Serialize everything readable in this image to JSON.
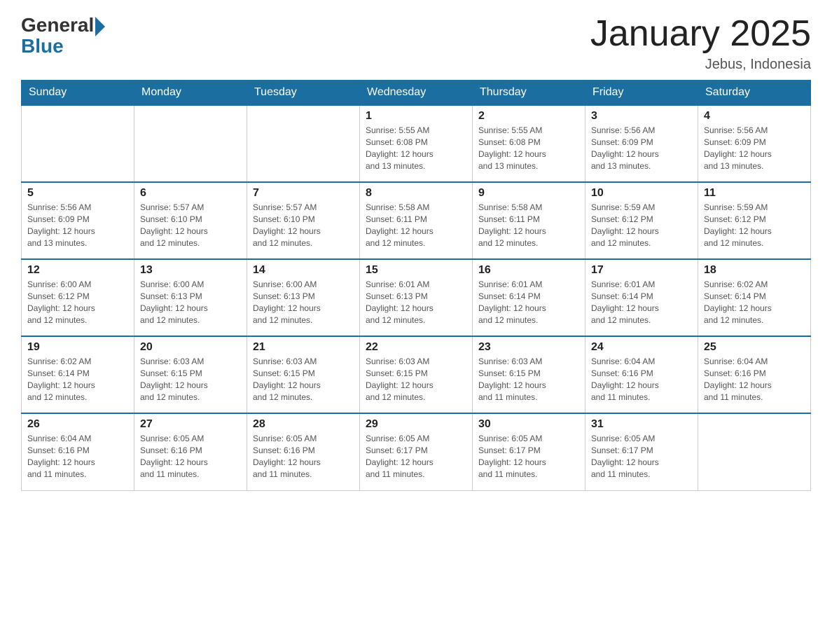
{
  "header": {
    "logo": {
      "text_general": "General",
      "text_blue": "Blue"
    },
    "title": "January 2025",
    "subtitle": "Jebus, Indonesia"
  },
  "days_of_week": [
    "Sunday",
    "Monday",
    "Tuesday",
    "Wednesday",
    "Thursday",
    "Friday",
    "Saturday"
  ],
  "weeks": [
    [
      {
        "day": "",
        "info": ""
      },
      {
        "day": "",
        "info": ""
      },
      {
        "day": "",
        "info": ""
      },
      {
        "day": "1",
        "info": "Sunrise: 5:55 AM\nSunset: 6:08 PM\nDaylight: 12 hours\nand 13 minutes."
      },
      {
        "day": "2",
        "info": "Sunrise: 5:55 AM\nSunset: 6:08 PM\nDaylight: 12 hours\nand 13 minutes."
      },
      {
        "day": "3",
        "info": "Sunrise: 5:56 AM\nSunset: 6:09 PM\nDaylight: 12 hours\nand 13 minutes."
      },
      {
        "day": "4",
        "info": "Sunrise: 5:56 AM\nSunset: 6:09 PM\nDaylight: 12 hours\nand 13 minutes."
      }
    ],
    [
      {
        "day": "5",
        "info": "Sunrise: 5:56 AM\nSunset: 6:09 PM\nDaylight: 12 hours\nand 13 minutes."
      },
      {
        "day": "6",
        "info": "Sunrise: 5:57 AM\nSunset: 6:10 PM\nDaylight: 12 hours\nand 12 minutes."
      },
      {
        "day": "7",
        "info": "Sunrise: 5:57 AM\nSunset: 6:10 PM\nDaylight: 12 hours\nand 12 minutes."
      },
      {
        "day": "8",
        "info": "Sunrise: 5:58 AM\nSunset: 6:11 PM\nDaylight: 12 hours\nand 12 minutes."
      },
      {
        "day": "9",
        "info": "Sunrise: 5:58 AM\nSunset: 6:11 PM\nDaylight: 12 hours\nand 12 minutes."
      },
      {
        "day": "10",
        "info": "Sunrise: 5:59 AM\nSunset: 6:12 PM\nDaylight: 12 hours\nand 12 minutes."
      },
      {
        "day": "11",
        "info": "Sunrise: 5:59 AM\nSunset: 6:12 PM\nDaylight: 12 hours\nand 12 minutes."
      }
    ],
    [
      {
        "day": "12",
        "info": "Sunrise: 6:00 AM\nSunset: 6:12 PM\nDaylight: 12 hours\nand 12 minutes."
      },
      {
        "day": "13",
        "info": "Sunrise: 6:00 AM\nSunset: 6:13 PM\nDaylight: 12 hours\nand 12 minutes."
      },
      {
        "day": "14",
        "info": "Sunrise: 6:00 AM\nSunset: 6:13 PM\nDaylight: 12 hours\nand 12 minutes."
      },
      {
        "day": "15",
        "info": "Sunrise: 6:01 AM\nSunset: 6:13 PM\nDaylight: 12 hours\nand 12 minutes."
      },
      {
        "day": "16",
        "info": "Sunrise: 6:01 AM\nSunset: 6:14 PM\nDaylight: 12 hours\nand 12 minutes."
      },
      {
        "day": "17",
        "info": "Sunrise: 6:01 AM\nSunset: 6:14 PM\nDaylight: 12 hours\nand 12 minutes."
      },
      {
        "day": "18",
        "info": "Sunrise: 6:02 AM\nSunset: 6:14 PM\nDaylight: 12 hours\nand 12 minutes."
      }
    ],
    [
      {
        "day": "19",
        "info": "Sunrise: 6:02 AM\nSunset: 6:14 PM\nDaylight: 12 hours\nand 12 minutes."
      },
      {
        "day": "20",
        "info": "Sunrise: 6:03 AM\nSunset: 6:15 PM\nDaylight: 12 hours\nand 12 minutes."
      },
      {
        "day": "21",
        "info": "Sunrise: 6:03 AM\nSunset: 6:15 PM\nDaylight: 12 hours\nand 12 minutes."
      },
      {
        "day": "22",
        "info": "Sunrise: 6:03 AM\nSunset: 6:15 PM\nDaylight: 12 hours\nand 12 minutes."
      },
      {
        "day": "23",
        "info": "Sunrise: 6:03 AM\nSunset: 6:15 PM\nDaylight: 12 hours\nand 11 minutes."
      },
      {
        "day": "24",
        "info": "Sunrise: 6:04 AM\nSunset: 6:16 PM\nDaylight: 12 hours\nand 11 minutes."
      },
      {
        "day": "25",
        "info": "Sunrise: 6:04 AM\nSunset: 6:16 PM\nDaylight: 12 hours\nand 11 minutes."
      }
    ],
    [
      {
        "day": "26",
        "info": "Sunrise: 6:04 AM\nSunset: 6:16 PM\nDaylight: 12 hours\nand 11 minutes."
      },
      {
        "day": "27",
        "info": "Sunrise: 6:05 AM\nSunset: 6:16 PM\nDaylight: 12 hours\nand 11 minutes."
      },
      {
        "day": "28",
        "info": "Sunrise: 6:05 AM\nSunset: 6:16 PM\nDaylight: 12 hours\nand 11 minutes."
      },
      {
        "day": "29",
        "info": "Sunrise: 6:05 AM\nSunset: 6:17 PM\nDaylight: 12 hours\nand 11 minutes."
      },
      {
        "day": "30",
        "info": "Sunrise: 6:05 AM\nSunset: 6:17 PM\nDaylight: 12 hours\nand 11 minutes."
      },
      {
        "day": "31",
        "info": "Sunrise: 6:05 AM\nSunset: 6:17 PM\nDaylight: 12 hours\nand 11 minutes."
      },
      {
        "day": "",
        "info": ""
      }
    ]
  ]
}
